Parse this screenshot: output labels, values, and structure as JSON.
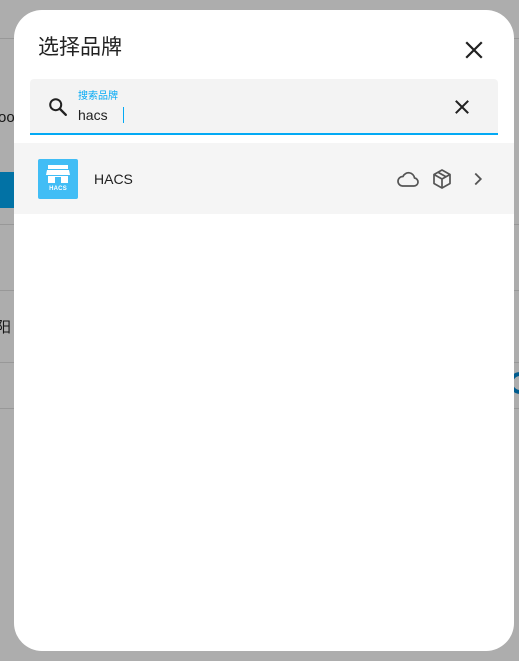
{
  "background": {
    "text_1": "oo",
    "text_2": "阳"
  },
  "dialog": {
    "title": "选择品牌",
    "close_icon": "close-icon"
  },
  "search": {
    "label": "搜索品牌",
    "value": "hacs",
    "icon": "search-icon",
    "clear_icon": "clear-icon"
  },
  "results": [
    {
      "name": "HACS",
      "logo_text": "HACS",
      "logo_color": "#41bdf5",
      "icons": [
        "cloud-icon",
        "package-icon",
        "chevron-right-icon"
      ]
    }
  ],
  "colors": {
    "accent": "#03a9f4",
    "scrim": "rgba(0,0,0,0.32)"
  }
}
